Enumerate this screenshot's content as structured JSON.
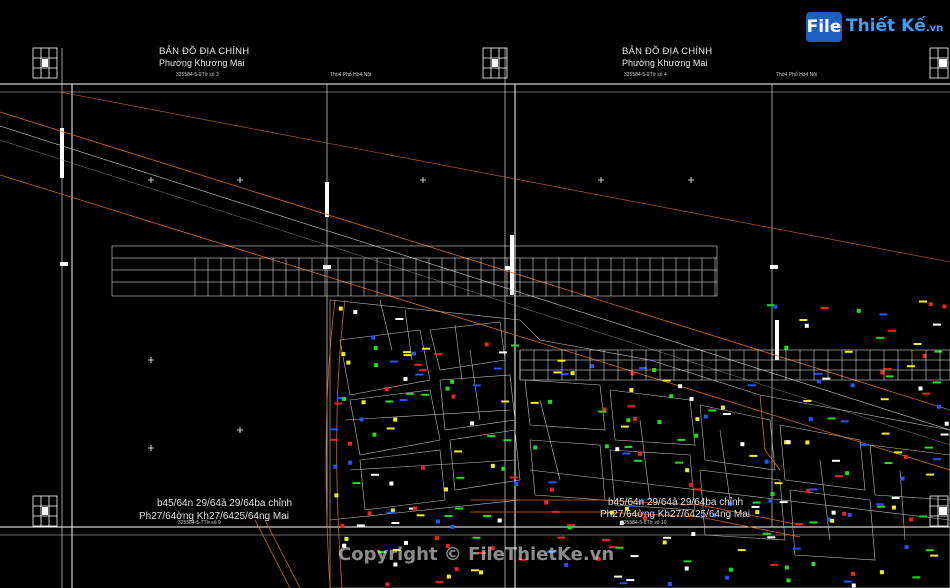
{
  "logo": {
    "brand": "File",
    "name": "Thiết Kế",
    "domain": ".vn"
  },
  "sheet_left": {
    "title": "BẢN ĐỒ ĐỊA CHÍNH",
    "subtitle": "Phường Khương Mai",
    "sheet_code": "325584-5-9Tờ số 3",
    "top_right_label": "Thö4 Phố Hö4 Nội",
    "bottom_title": "b45/64n 29/64ả 29/64ba chỉnh",
    "bottom_subtitle": "Ph27/64ờng Kh27/6425/64ng Mai",
    "bottom_code": "325584-5-7Tờ số 9"
  },
  "sheet_right": {
    "title": "BẢN ĐỒ ĐỊA CHÍNH",
    "subtitle": "Phường Khương Mai",
    "sheet_code": "325584-5-9Tờ số 4",
    "top_right_label": "Thö4 Phố Hö4 Nội",
    "bottom_title": "b45/64n 29/64ả 29/64ba chỉnh",
    "bottom_subtitle": "Ph27/64ờng Kh27/6425/64ng Mai",
    "bottom_code": "325584-5-8Tờ số 10"
  },
  "watermark": "Copyright © FileThietKe.vn",
  "colors": {
    "background": "#000000",
    "frame": "#ffffff",
    "parcel": "#c0c0c0",
    "road": "#d2691e",
    "marker_green": "#22dd22",
    "marker_yellow": "#eeee22",
    "marker_red": "#ee2222",
    "marker_blue": "#2255ff"
  }
}
